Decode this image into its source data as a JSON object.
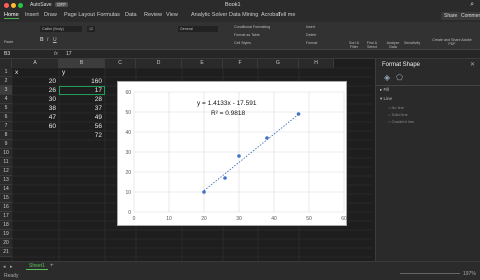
{
  "window": {
    "autosave": "AutoSave",
    "autosave_state": "OFF",
    "title": "Book1"
  },
  "tabs": [
    "Home",
    "Insert",
    "Draw",
    "Page Layout",
    "Formulas",
    "Data",
    "Review",
    "View",
    "Analytic Solver",
    "Data Mining",
    "Acrobat",
    "Tell me"
  ],
  "share": "Share",
  "comments": "Comments",
  "ribbon": {
    "paste": "Paste",
    "font_name": "Calibri (Body)",
    "font_size": "12",
    "number_format": "General",
    "cond_fmt": "Conditional Formatting",
    "fmt_table": "Format as Table",
    "cell_styles": "Cell Styles",
    "insert": "Insert",
    "delete": "Delete",
    "format": "Format",
    "sort_filter": "Sort & Filter",
    "find_select": "Find & Select",
    "analyze": "Analyze Data",
    "sensitivity": "Sensitivity",
    "create_share": "Create and Share Adobe PDF"
  },
  "formula": {
    "name_box": "B3",
    "fx": "fx",
    "value": "17"
  },
  "columns": [
    "A",
    "B",
    "C",
    "D",
    "E",
    "F",
    "G",
    "H"
  ],
  "rows": [
    "1",
    "2",
    "3",
    "4",
    "5",
    "6",
    "7",
    "8",
    "9",
    "10",
    "11",
    "12",
    "13",
    "14",
    "15",
    "16",
    "17",
    "18",
    "19",
    "20",
    "21"
  ],
  "cells": {
    "A1": "x",
    "B1": "y",
    "A2": "20",
    "B2": "160",
    "A3": "26",
    "B3": "17",
    "A4": "30",
    "B4": "28",
    "A5": "38",
    "B5": "37",
    "A6": "47",
    "B6": "49",
    "A7": "60",
    "B7": "56",
    "B8": "72"
  },
  "chart_data": {
    "type": "scatter",
    "series": [
      {
        "x": [
          20,
          26,
          30,
          38,
          47
        ],
        "y": [
          10,
          17,
          28,
          37,
          49
        ]
      }
    ],
    "trendline": {
      "slope": 1.4133,
      "intercept": -17.591
    },
    "equation": "y = 1.4133x - 17.591",
    "r2": "R² = 0.9818",
    "xlim": [
      0,
      60
    ],
    "ylim": [
      0,
      60
    ],
    "xticks": [
      "0",
      "10",
      "20",
      "30",
      "40",
      "50",
      "60"
    ],
    "yticks": [
      "0",
      "10",
      "20",
      "30",
      "40",
      "50",
      "60"
    ],
    "grid": true,
    "colors": {
      "point": "#4472c4",
      "trend": "#4472c4"
    }
  },
  "pane": {
    "title": "Format Shape",
    "fill": "Fill",
    "line": "Line",
    "no_line": "No line",
    "solid": "Solid line",
    "gradient": "Gradient line"
  },
  "sheet": {
    "name": "Sheet1",
    "ready": "Ready",
    "zoom": "197%"
  }
}
